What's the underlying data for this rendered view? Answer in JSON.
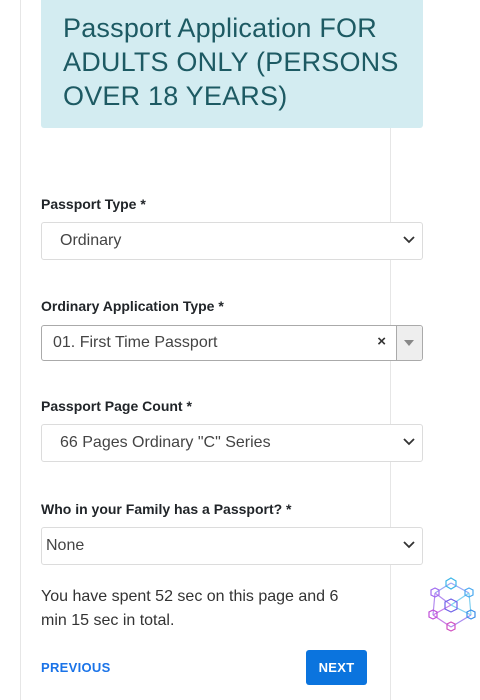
{
  "page": {
    "title": "Passport Application FOR ADULTS ONLY (PERSONS OVER 18 YEARS)"
  },
  "form": {
    "passport_type": {
      "label": "Passport Type *",
      "value": "Ordinary"
    },
    "application_type": {
      "label": "Ordinary Application Type *",
      "value": "01. First Time Passport",
      "clear_symbol": "×"
    },
    "page_count": {
      "label": "Passport Page Count *",
      "value": "66 Pages Ordinary \"C\" Series"
    },
    "family_passport": {
      "label": "Who in your Family has a Passport? *",
      "value": "None"
    }
  },
  "timer": {
    "text": "You have spent 52 sec on this page and 6 min 15 sec in total."
  },
  "navigation": {
    "previous_label": "PREVIOUS",
    "next_label": "NEXT"
  },
  "colors": {
    "title_bg": "#d3ecf1",
    "title_text": "#1d5a63",
    "accent": "#0b74de"
  },
  "icons": {
    "chevron": "chevron-down-icon",
    "network": "cube-network-icon"
  }
}
